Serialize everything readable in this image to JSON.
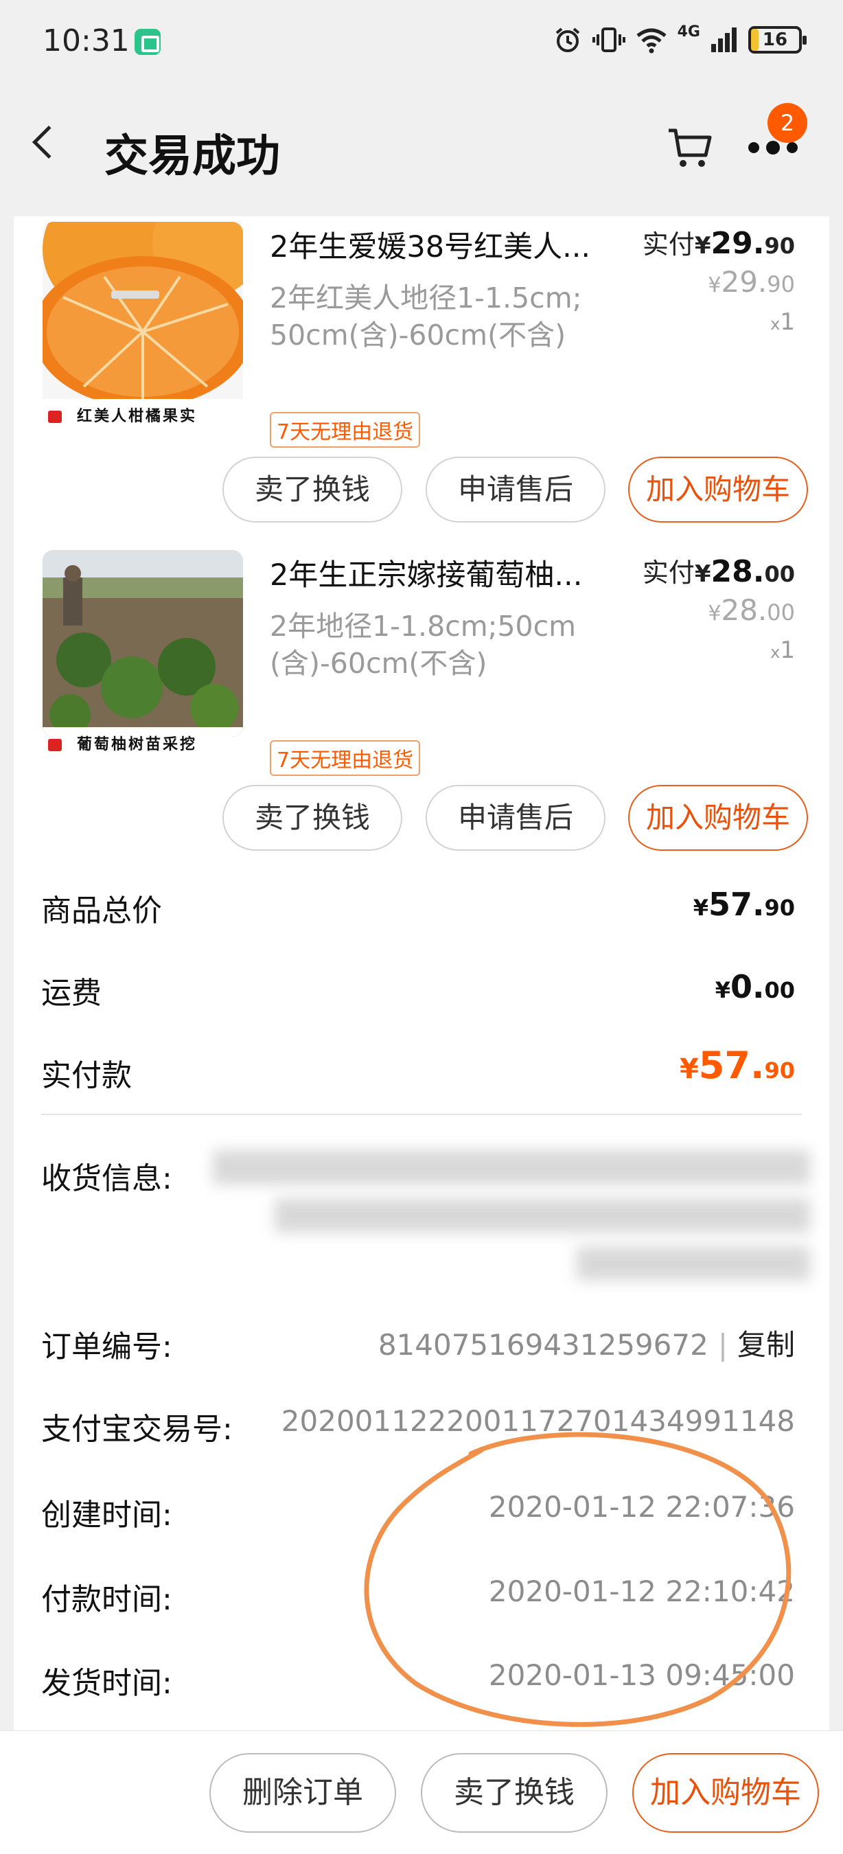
{
  "status_bar": {
    "time": "10:31",
    "network": "4G",
    "battery": "16",
    "battery_level_percent": 16
  },
  "header": {
    "title": "交易成功",
    "cart_badge": "2"
  },
  "items": [
    {
      "title": "2年生爱媛38号红美人...",
      "spec": "2年红美人地径1-1.5cm;50cm(含)-60cm(不含)",
      "image_caption": "红美人柑橘果实",
      "return_tag": "7天无理由退货",
      "paid_label": "实付",
      "paid_currency": "¥",
      "paid_int": "29.",
      "paid_dec": "90",
      "orig_currency": "¥",
      "orig_int": "29.",
      "orig_dec": "90",
      "qty_x": "x",
      "qty_num": "1",
      "btn_sell": "卖了换钱",
      "btn_aftersale": "申请售后",
      "btn_add_cart": "加入购物车"
    },
    {
      "title": "2年生正宗嫁接葡萄柚...",
      "spec": "2年地径1-1.8cm;50cm(含)-60cm(不含)",
      "image_caption": "葡萄柚树苗采挖",
      "return_tag": "7天无理由退货",
      "paid_label": "实付",
      "paid_currency": "¥",
      "paid_int": "28.",
      "paid_dec": "00",
      "orig_currency": "¥",
      "orig_int": "28.",
      "orig_dec": "00",
      "qty_x": "x",
      "qty_num": "1",
      "btn_sell": "卖了换钱",
      "btn_aftersale": "申请售后",
      "btn_add_cart": "加入购物车"
    }
  ],
  "summary": {
    "goods_total_label": "商品总价",
    "goods_total": {
      "c": "¥",
      "i": "57.",
      "d": "90"
    },
    "shipping_label": "运费",
    "shipping": {
      "c": "¥",
      "i": "0.",
      "d": "00"
    },
    "actual_label": "实付款",
    "actual": {
      "c": "¥",
      "i": "57.",
      "d": "90"
    }
  },
  "order_info": {
    "address_label": "收货信息:",
    "order_no_label": "订单编号:",
    "order_no": "814075169431259672",
    "order_no_sep": "|",
    "copy_label": "复制",
    "alipay_label": "支付宝交易号:",
    "alipay_no": "2020011222001172701434991148",
    "created_label": "创建时间:",
    "created_time": "2020-01-12 22:07:36",
    "paid_label": "付款时间:",
    "paid_time": "2020-01-12 22:10:42",
    "shipped_label": "发货时间:",
    "shipped_time": "2020-01-13 09:45:00"
  },
  "bottom_bar": {
    "delete_order": "删除订单",
    "sell": "卖了换钱",
    "add_cart": "加入购物车"
  },
  "colors": {
    "accent": "#ff5a00",
    "button_orange": "#e85f1c",
    "annotation": "#f0904a"
  }
}
